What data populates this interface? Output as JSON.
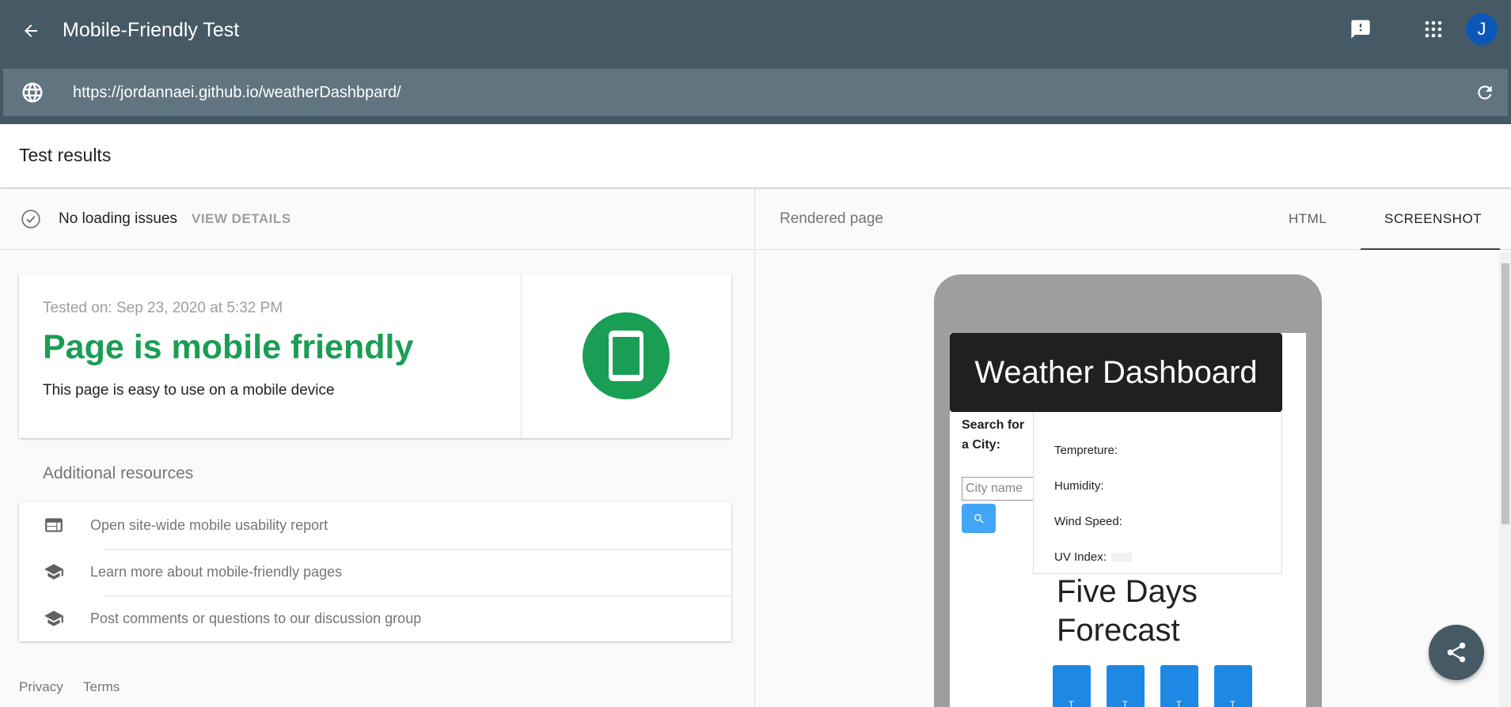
{
  "app": {
    "title": "Mobile-Friendly Test",
    "avatar_initial": "J",
    "url": "https://jordannaei.github.io/weatherDashbpard/"
  },
  "results": {
    "header": "Test results",
    "status_text": "No loading issues",
    "view_details": "VIEW DETAILS"
  },
  "card": {
    "tested_on": "Tested on: Sep 23, 2020 at 5:32 PM",
    "verdict": "Page is mobile friendly",
    "verdict_sub": "This page is easy to use on a mobile device"
  },
  "resources": {
    "title": "Additional resources",
    "items": [
      {
        "label": "Open site-wide mobile usability report",
        "icon": "web-panel-icon"
      },
      {
        "label": "Learn more about mobile-friendly pages",
        "icon": "school-icon"
      },
      {
        "label": "Post comments or questions to our discussion group",
        "icon": "school-icon"
      }
    ]
  },
  "footer": {
    "privacy": "Privacy",
    "terms": "Terms"
  },
  "right": {
    "rendered_label": "Rendered page",
    "tab_html": "HTML",
    "tab_screenshot": "SCREENSHOT"
  },
  "preview": {
    "header": "Weather Dashboard",
    "search_label": "Search for a City:",
    "city_placeholder": "City name",
    "temperature": "Tempreture:",
    "humidity": "Humidity:",
    "wind": "Wind Speed:",
    "uv": "UV Index:",
    "forecast_title": "Five Days Forecast",
    "day_letter": "T"
  },
  "colors": {
    "appbar": "#455a64",
    "urlbar": "#607580",
    "success_green": "#1a9d54",
    "avatar_blue": "#0b57b8",
    "forecast_blue": "#1e88e5"
  }
}
